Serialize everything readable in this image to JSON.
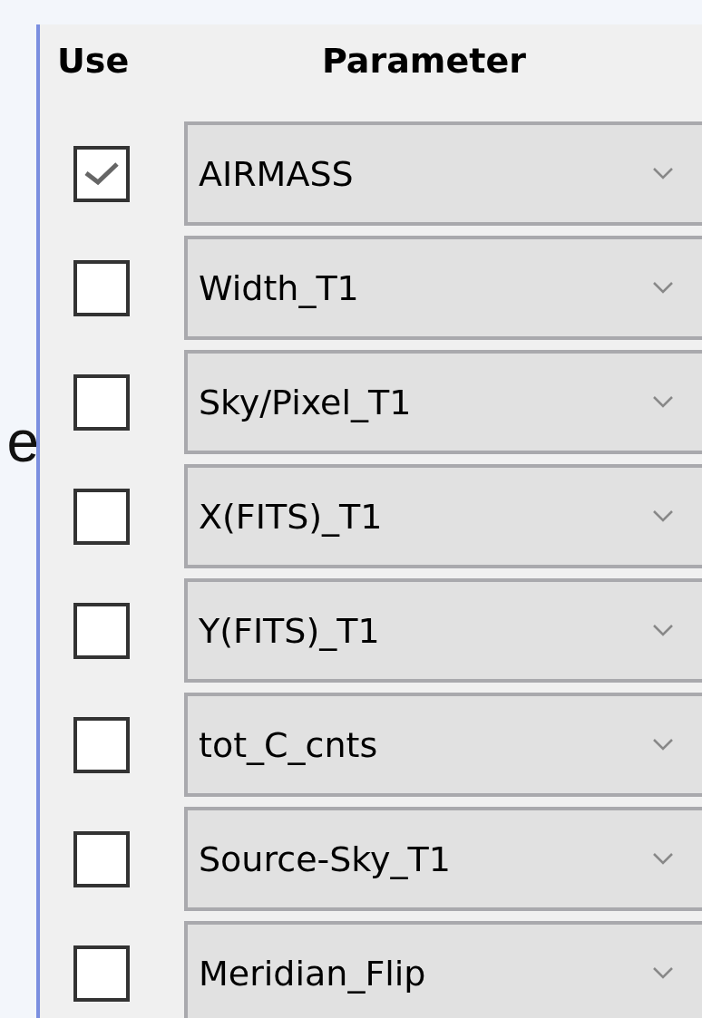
{
  "side_label": "e",
  "columns": [
    "Use",
    "Parameter"
  ],
  "rows": [
    {
      "checked": true,
      "parameter": "AIRMASS"
    },
    {
      "checked": false,
      "parameter": "Width_T1"
    },
    {
      "checked": false,
      "parameter": "Sky/Pixel_T1"
    },
    {
      "checked": false,
      "parameter": "X(FITS)_T1"
    },
    {
      "checked": false,
      "parameter": "Y(FITS)_T1"
    },
    {
      "checked": false,
      "parameter": "tot_C_cnts"
    },
    {
      "checked": false,
      "parameter": "Source-Sky_T1"
    },
    {
      "checked": false,
      "parameter": "Meridian_Flip"
    }
  ]
}
